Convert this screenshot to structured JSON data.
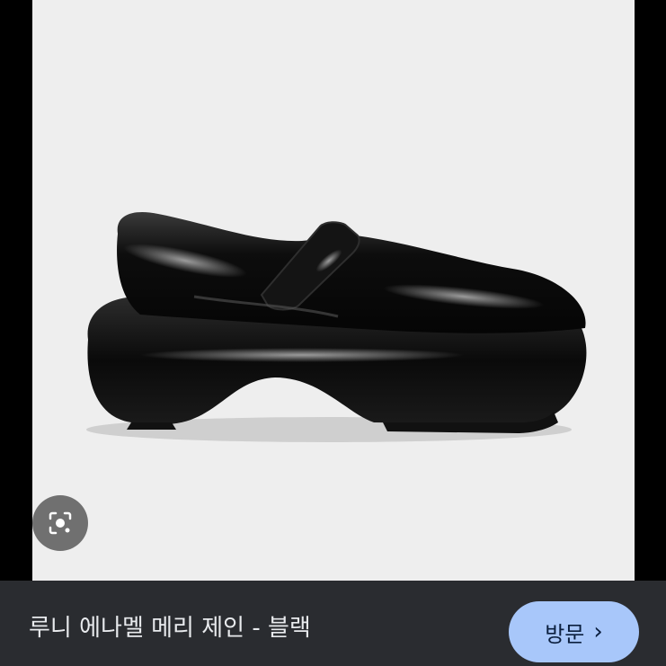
{
  "image": {
    "subject_icon": "shoe-photo",
    "background_color": "#eeeeee"
  },
  "lens_button": {
    "icon": "lens-camera-icon"
  },
  "bottom_bar": {
    "title": "루니 에나멜 메리 제인 - 블랙",
    "visit_label": "방문",
    "visit_chevron": "›",
    "accent_color": "#a8c7fa",
    "bar_color": "#2a2c30"
  }
}
